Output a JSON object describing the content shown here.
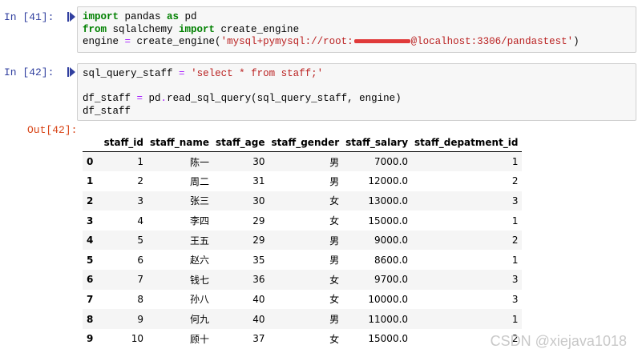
{
  "cells": [
    {
      "prompt": "In  [41]:",
      "lines": [
        [
          {
            "t": "import",
            "c": "kw"
          },
          {
            "t": " pandas "
          },
          {
            "t": "as",
            "c": "kw"
          },
          {
            "t": " pd"
          }
        ],
        [
          {
            "t": "from",
            "c": "kw"
          },
          {
            "t": " sqlalchemy "
          },
          {
            "t": "import",
            "c": "kw"
          },
          {
            "t": " create_engine"
          }
        ],
        [
          {
            "t": "engine "
          },
          {
            "t": "=",
            "c": "op"
          },
          {
            "t": " create_engine("
          },
          {
            "t": "'mysql+pymysql://root:",
            "c": "str"
          },
          {
            "t": "",
            "c": "redact"
          },
          {
            "t": "@localhost:3306/pandastest'",
            "c": "str"
          },
          {
            "t": ")"
          }
        ]
      ]
    },
    {
      "prompt": "In  [42]:",
      "lines": [
        [
          {
            "t": "sql_query_staff "
          },
          {
            "t": "=",
            "c": "op"
          },
          {
            "t": " "
          },
          {
            "t": "'select * from staff;'",
            "c": "str"
          }
        ],
        [
          {
            "t": ""
          }
        ],
        [
          {
            "t": "df_staff "
          },
          {
            "t": "=",
            "c": "op"
          },
          {
            "t": " pd"
          },
          {
            "t": ".",
            "c": "op"
          },
          {
            "t": "read_sql_query(sql_query_staff, engine)"
          }
        ],
        [
          {
            "t": "df_staff"
          }
        ]
      ]
    }
  ],
  "output_prompt": "Out[42]:",
  "table": {
    "columns": [
      "",
      "staff_id",
      "staff_name",
      "staff_age",
      "staff_gender",
      "staff_salary",
      "staff_depatment_id"
    ],
    "rows": [
      [
        "0",
        "1",
        "陈一",
        "30",
        "男",
        "7000.0",
        "1"
      ],
      [
        "1",
        "2",
        "周二",
        "31",
        "男",
        "12000.0",
        "2"
      ],
      [
        "2",
        "3",
        "张三",
        "30",
        "女",
        "13000.0",
        "3"
      ],
      [
        "3",
        "4",
        "李四",
        "29",
        "女",
        "15000.0",
        "1"
      ],
      [
        "4",
        "5",
        "王五",
        "29",
        "男",
        "9000.0",
        "2"
      ],
      [
        "5",
        "6",
        "赵六",
        "35",
        "男",
        "8600.0",
        "1"
      ],
      [
        "6",
        "7",
        "钱七",
        "36",
        "女",
        "9700.0",
        "3"
      ],
      [
        "7",
        "8",
        "孙八",
        "40",
        "女",
        "10000.0",
        "3"
      ],
      [
        "8",
        "9",
        "何九",
        "40",
        "男",
        "11000.0",
        "1"
      ],
      [
        "9",
        "10",
        "顾十",
        "37",
        "女",
        "15000.0",
        "2"
      ]
    ]
  },
  "watermark": "CSDN @xiejava1018",
  "colors": {
    "prompt_in": "#303f9f",
    "prompt_out": "#d84315",
    "keyword": "#008000",
    "string": "#ba2121",
    "operator": "#aa22ff"
  }
}
